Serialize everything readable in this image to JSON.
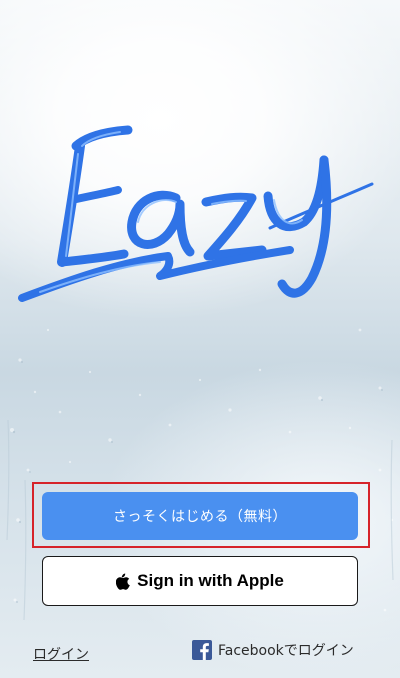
{
  "app": {
    "logo_text": "Eazy",
    "brand_color": "#2f73e6"
  },
  "actions": {
    "start_free_label": "さっそくはじめる（無料）",
    "apple_signin_label": "Sign in with Apple",
    "apple_icon": "apple-logo-icon"
  },
  "footer": {
    "login_label": "ログイン",
    "facebook_login_label": "Facebookでログイン",
    "facebook_icon": "facebook-icon"
  },
  "colors": {
    "primary_button": "#4a90f0",
    "highlight_border": "#d6232a"
  }
}
